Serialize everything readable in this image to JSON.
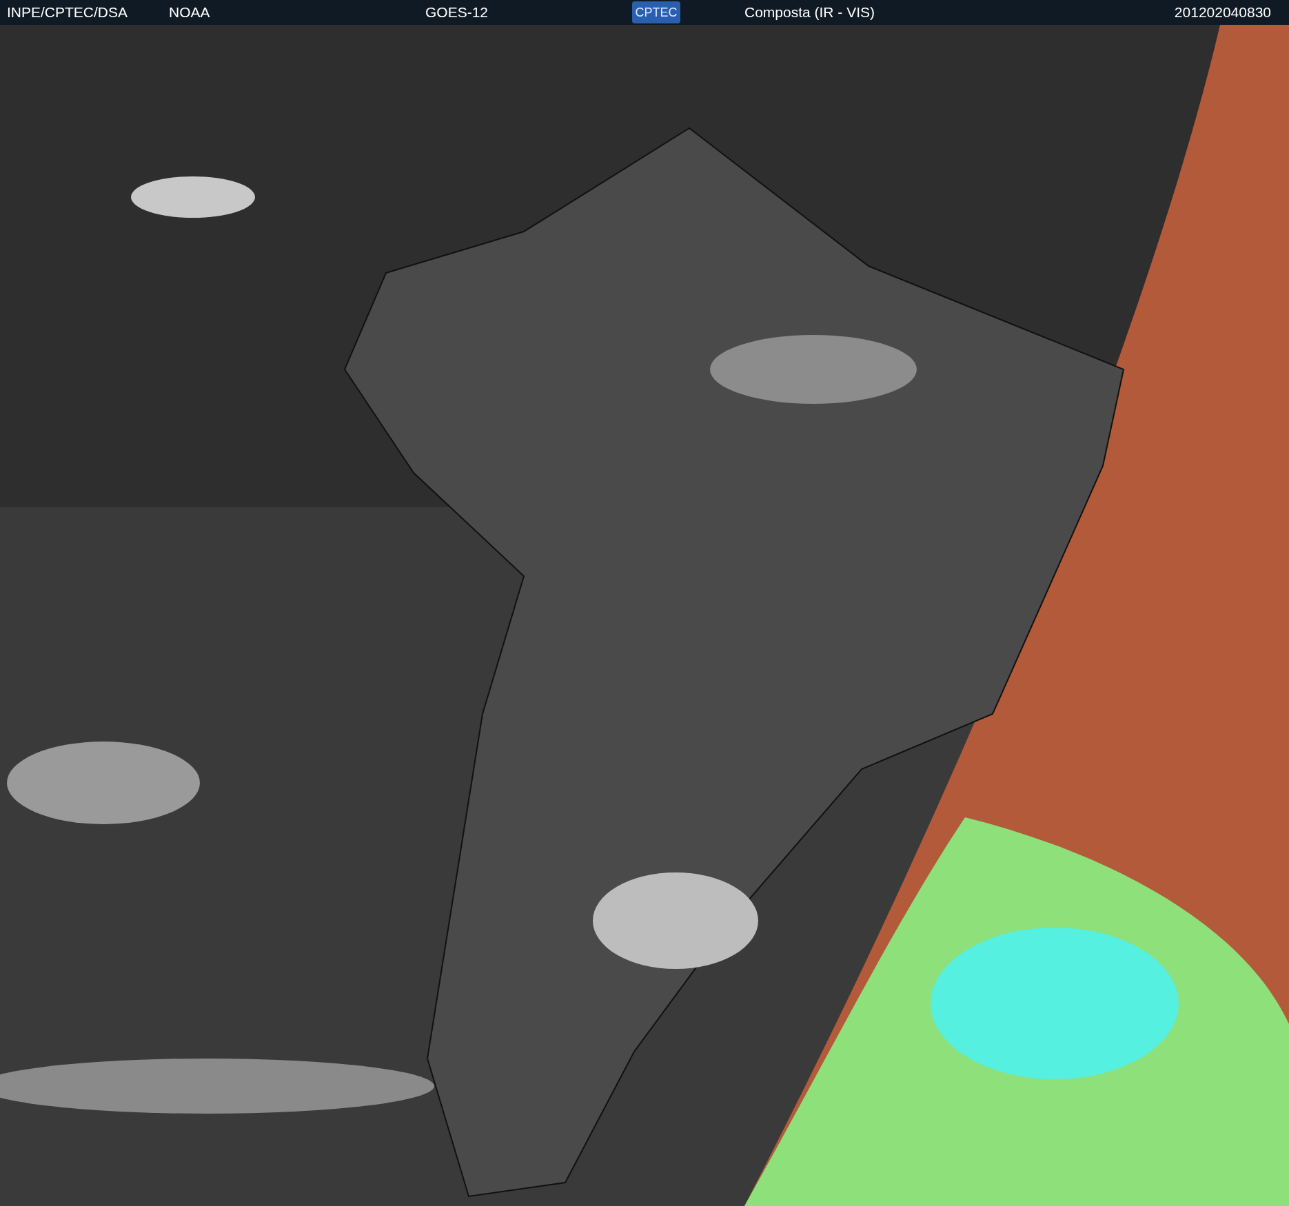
{
  "header": {
    "source": "INPE/CPTEC/DSA",
    "agency": "NOAA",
    "satellite": "GOES-12",
    "logo_text": "CPTEC",
    "product": "Composta (IR - VIS)",
    "timestamp": "201202040830"
  }
}
